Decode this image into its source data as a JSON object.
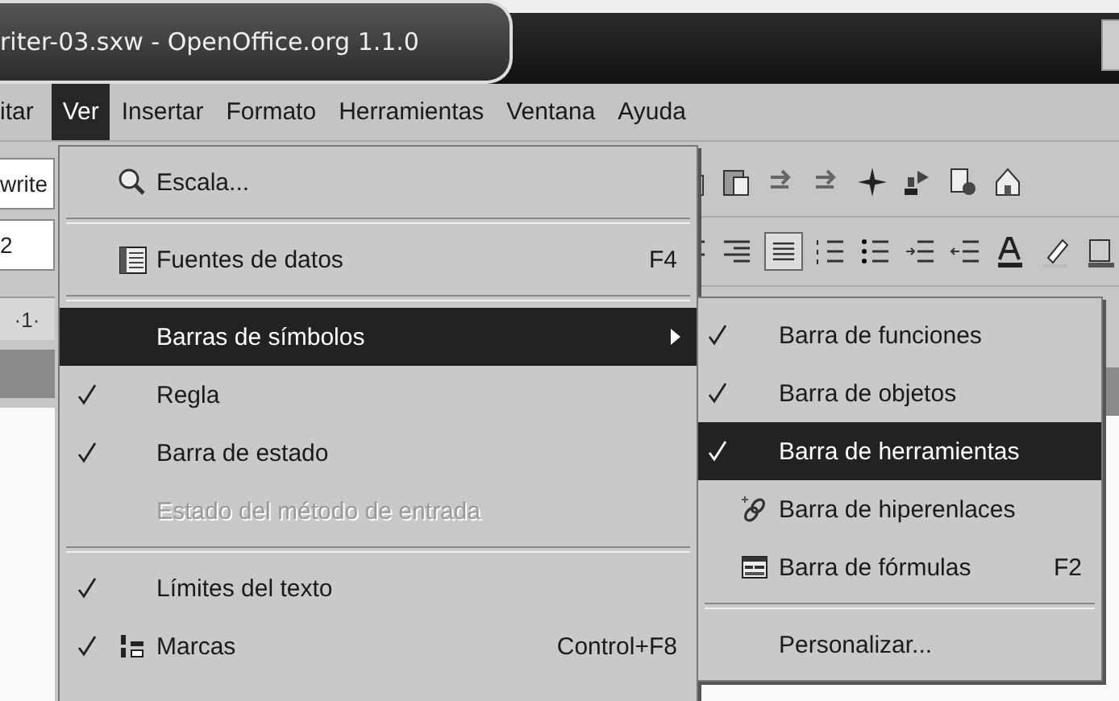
{
  "window": {
    "title": "riter-03.sxw - OpenOffice.org 1.1.0"
  },
  "menubar": [
    {
      "label": "itar",
      "selected": false
    },
    {
      "label": "Ver",
      "selected": true
    },
    {
      "label": "Insertar",
      "selected": false
    },
    {
      "label": "Formato",
      "selected": false
    },
    {
      "label": "Herramientas",
      "selected": false
    },
    {
      "label": "Ventana",
      "selected": false
    },
    {
      "label": "Ayuda",
      "selected": false
    }
  ],
  "left_toolbar": {
    "style_field": "write",
    "size_field": "2",
    "ruler": "·1·"
  },
  "main_menu": [
    {
      "kind": "item",
      "label": "Escala...",
      "checked": false,
      "selected": false,
      "disabled": false
    },
    {
      "kind": "separator"
    },
    {
      "kind": "item",
      "label": "Fuentes de datos",
      "shortcut": "F4",
      "checked": false,
      "selected": false,
      "disabled": false
    },
    {
      "kind": "separator"
    },
    {
      "kind": "submenu",
      "label": "Barras de símbolos",
      "checked": false,
      "selected": true,
      "disabled": false
    },
    {
      "kind": "item",
      "label": "Regla",
      "checked": true,
      "selected": false,
      "disabled": false
    },
    {
      "kind": "item",
      "label": "Barra de estado",
      "checked": true,
      "selected": false,
      "disabled": false
    },
    {
      "kind": "item",
      "label": "Estado del método de entrada",
      "checked": false,
      "selected": false,
      "disabled": true
    },
    {
      "kind": "separator"
    },
    {
      "kind": "item",
      "label": "Límites del texto",
      "checked": true,
      "selected": false,
      "disabled": false
    },
    {
      "kind": "item",
      "label": "Marcas",
      "shortcut": "Control+F8",
      "checked": true,
      "selected": false,
      "disabled": false
    }
  ],
  "submenu": [
    {
      "kind": "item",
      "label": "Barra de funciones",
      "checked": true,
      "selected": false,
      "disabled": false
    },
    {
      "kind": "item",
      "label": "Barra de objetos",
      "checked": true,
      "selected": false,
      "disabled": false
    },
    {
      "kind": "item",
      "label": "Barra de herramientas",
      "checked": true,
      "selected": true,
      "disabled": false
    },
    {
      "kind": "item",
      "label": "Barra de hiperenlaces",
      "checked": false,
      "selected": false,
      "disabled": false
    },
    {
      "kind": "item",
      "label": "Barra de fórmulas",
      "shortcut": "F2",
      "checked": false,
      "selected": false,
      "disabled": false
    },
    {
      "kind": "separator"
    },
    {
      "kind": "item",
      "label": "Personalizar...",
      "checked": false,
      "selected": false,
      "disabled": false
    }
  ]
}
